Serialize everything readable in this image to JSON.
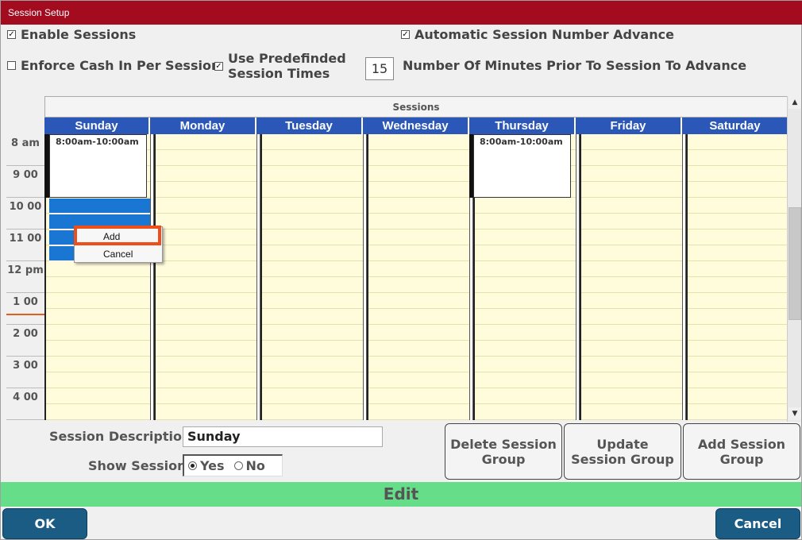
{
  "window": {
    "title": "Session Setup"
  },
  "options": {
    "enable_sessions": {
      "label": "Enable Sessions",
      "checked": true
    },
    "auto_advance": {
      "label": "Automatic Session Number Advance",
      "checked": true
    },
    "enforce_cash": {
      "label": "Enforce Cash In Per Session",
      "checked": false
    },
    "predefined_times": {
      "label_line1": "Use Predefinded",
      "label_line2": "Session Times",
      "checked": true
    },
    "minutes_prior": {
      "value": "15",
      "label": "Number Of Minutes Prior To Session To Advance"
    }
  },
  "calendar": {
    "header": "Sessions",
    "days": [
      "Sunday",
      "Monday",
      "Tuesday",
      "Wednesday",
      "Thursday",
      "Friday",
      "Saturday"
    ],
    "times": [
      "8 am",
      "9 00",
      "10 00",
      "11 00",
      "12 pm",
      "1 00",
      "2 00",
      "3 00",
      "4 00"
    ],
    "events": [
      {
        "day": "Sunday",
        "label": "8:00am-10:00am"
      },
      {
        "day": "Thursday",
        "label": "8:00am-10:00am"
      }
    ],
    "context_menu": {
      "items": [
        "Add",
        "Cancel"
      ]
    }
  },
  "form": {
    "description_label": "Session Description",
    "description_value": "Sunday",
    "show_label": "Show Session",
    "show_yes": "Yes",
    "show_no": "No",
    "show_value": "Yes"
  },
  "actions": {
    "delete": "Delete Session Group",
    "update": "Update Session Group",
    "add": "Add Session Group"
  },
  "status": "Edit",
  "buttons": {
    "ok": "OK",
    "cancel": "Cancel"
  },
  "colors": {
    "titlebar": "#a30b1f",
    "day_header": "#2a57b8",
    "selection": "#1976d2",
    "status_bar": "#66dd88",
    "footer_button": "#1a5c84",
    "highlight": "#ee4e1a"
  }
}
